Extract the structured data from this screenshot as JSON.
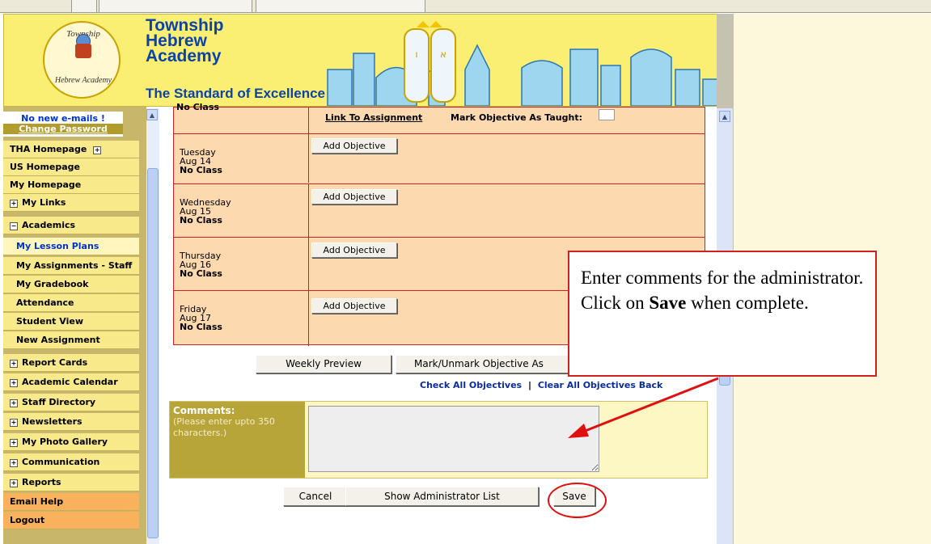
{
  "header": {
    "school_line1": "Township",
    "school_line2": "Hebrew",
    "school_line3": "Academy",
    "tagline": "The Standard of Excellence",
    "logo_top": "Township",
    "logo_bottom": "Hebrew Academy"
  },
  "sidebar": {
    "mail_status": "No new e-mails !",
    "change_password": "Change Password",
    "items": [
      {
        "label": "THA Homepage",
        "icon": "plus-icon"
      },
      {
        "label": "US Homepage"
      },
      {
        "label": "My Homepage"
      },
      {
        "label": "My Links",
        "icon": "plus-icon"
      },
      {
        "label": "Academics",
        "icon": "minus-icon"
      },
      {
        "label": "My Lesson Plans"
      },
      {
        "label": "My Assignments - Staff"
      },
      {
        "label": "My Gradebook"
      },
      {
        "label": "Attendance"
      },
      {
        "label": "Student View"
      },
      {
        "label": "New Assignment"
      },
      {
        "label": "Report Cards",
        "icon": "plus-icon"
      },
      {
        "label": "Academic Calendar",
        "icon": "plus-icon"
      },
      {
        "label": "Staff Directory",
        "icon": "plus-icon"
      },
      {
        "label": "Newsletters",
        "icon": "plus-icon"
      },
      {
        "label": "My Photo Gallery",
        "icon": "plus-icon"
      },
      {
        "label": "Communication",
        "icon": "plus-icon"
      },
      {
        "label": "Reports",
        "icon": "plus-icon"
      },
      {
        "label": "Email Help"
      },
      {
        "label": "Logout"
      }
    ]
  },
  "lesson_table": {
    "top_row": {
      "day_fragment": "No Class",
      "link_assignment": "Link To Assignment",
      "mark_taught": "Mark Objective As Taught:"
    },
    "rows": [
      {
        "day": "Tuesday",
        "date": "Aug 14",
        "status": "No Class",
        "button": "Add Objective"
      },
      {
        "day": "Wednesday",
        "date": "Aug 15",
        "status": "No Class",
        "button": "Add Objective"
      },
      {
        "day": "Thursday",
        "date": "Aug 16",
        "status": "No Class",
        "button": "Add Objective"
      },
      {
        "day": "Friday",
        "date": "Aug 17",
        "status": "No Class",
        "button": "Add Objective"
      }
    ]
  },
  "actions": {
    "weekly_preview": "Weekly Preview",
    "mark_unmark": "Mark/Unmark Objective As",
    "check_all": "Check All Objectives",
    "clear_all": "Clear All Objectives",
    "back": "Back"
  },
  "comments": {
    "label": "Comments:",
    "hint": "(Please enter upto 350 characters.)",
    "value": ""
  },
  "footer_buttons": {
    "cancel": "Cancel",
    "show_admin": "Show Administrator List",
    "save": "Save"
  },
  "callout": {
    "text_before": "Enter comments for the administrator.  Click on",
    "bold_word": "Save",
    "text_after": "when complete."
  },
  "colors": {
    "header_bg": "#fbef73",
    "sidebar_bg": "#c8b76b",
    "table_bg": "#fdd9b0",
    "table_border": "#cc2222",
    "highlight": "#e01010"
  }
}
